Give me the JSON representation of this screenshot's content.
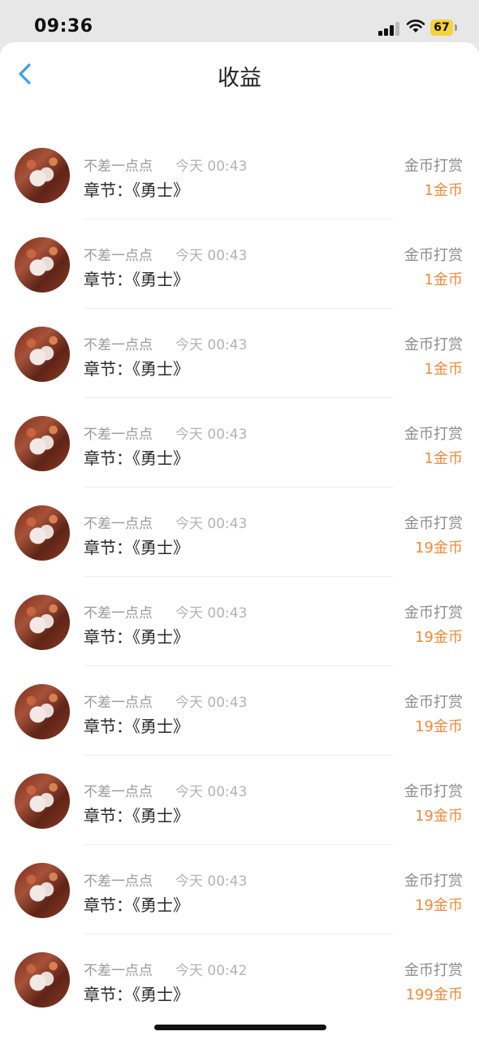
{
  "status_bar": {
    "time": "09:36",
    "battery": "67"
  },
  "header": {
    "title": "收益"
  },
  "items": [
    {
      "name": "不差一点点",
      "time": "今天 00:43",
      "chapter": "章节：《勇士》",
      "type": "金币打赏",
      "amount": "1金币"
    },
    {
      "name": "不差一点点",
      "time": "今天 00:43",
      "chapter": "章节：《勇士》",
      "type": "金币打赏",
      "amount": "1金币"
    },
    {
      "name": "不差一点点",
      "time": "今天 00:43",
      "chapter": "章节：《勇士》",
      "type": "金币打赏",
      "amount": "1金币"
    },
    {
      "name": "不差一点点",
      "time": "今天 00:43",
      "chapter": "章节：《勇士》",
      "type": "金币打赏",
      "amount": "1金币"
    },
    {
      "name": "不差一点点",
      "time": "今天 00:43",
      "chapter": "章节：《勇士》",
      "type": "金币打赏",
      "amount": "19金币"
    },
    {
      "name": "不差一点点",
      "time": "今天 00:43",
      "chapter": "章节：《勇士》",
      "type": "金币打赏",
      "amount": "19金币"
    },
    {
      "name": "不差一点点",
      "time": "今天 00:43",
      "chapter": "章节：《勇士》",
      "type": "金币打赏",
      "amount": "19金币"
    },
    {
      "name": "不差一点点",
      "time": "今天 00:43",
      "chapter": "章节：《勇士》",
      "type": "金币打赏",
      "amount": "19金币"
    },
    {
      "name": "不差一点点",
      "time": "今天 00:43",
      "chapter": "章节：《勇士》",
      "type": "金币打赏",
      "amount": "19金币"
    },
    {
      "name": "不差一点点",
      "time": "今天 00:42",
      "chapter": "章节：《勇士》",
      "type": "金币打赏",
      "amount": "199金币"
    }
  ]
}
